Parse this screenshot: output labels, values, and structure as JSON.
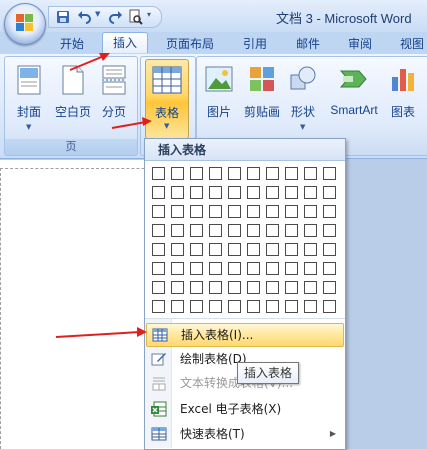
{
  "window": {
    "title": "文档 3 - Microsoft Word"
  },
  "tabs": [
    {
      "label": "开始"
    },
    {
      "label": "插入"
    },
    {
      "label": "页面布局"
    },
    {
      "label": "引用"
    },
    {
      "label": "邮件"
    },
    {
      "label": "审阅"
    },
    {
      "label": "视图"
    }
  ],
  "ribbon": {
    "pages_group": {
      "label": "页",
      "buttons": [
        {
          "label": "封面",
          "icon": "cover-page-icon"
        },
        {
          "label": "空白页",
          "icon": "blank-page-icon"
        },
        {
          "label": "分页",
          "icon": "page-break-icon"
        }
      ]
    },
    "table_group": {
      "button_label": "表格",
      "icon": "table-icon"
    },
    "illustrations_group": {
      "buttons": [
        {
          "label": "图片",
          "icon": "picture-icon"
        },
        {
          "label": "剪贴画",
          "icon": "clipart-icon"
        },
        {
          "label": "形状",
          "icon": "shapes-icon"
        },
        {
          "label": "SmartArt",
          "icon": "smartart-icon"
        },
        {
          "label": "图表",
          "icon": "chart-icon"
        }
      ]
    }
  },
  "table_menu": {
    "header": "插入表格",
    "grid": {
      "columns": 10,
      "rows": 8
    },
    "items": [
      {
        "label": "插入表格(I)...",
        "icon": "insert-table-icon",
        "highlighted": true
      },
      {
        "label": "绘制表格(D)",
        "icon": "draw-table-icon"
      },
      {
        "label": "文本转换成表格(V)...",
        "icon": "convert-text-icon",
        "disabled": true
      },
      {
        "label": "Excel 电子表格(X)",
        "icon": "excel-sheet-icon"
      },
      {
        "label": "快速表格(T)",
        "icon": "quick-table-icon",
        "submenu": true
      }
    ]
  },
  "tooltip": {
    "text": "插入表格"
  },
  "colors": {
    "accent_highlight": "#ffd970",
    "annotation_arrow": "#e02020",
    "ribbon_text": "#15428b"
  }
}
